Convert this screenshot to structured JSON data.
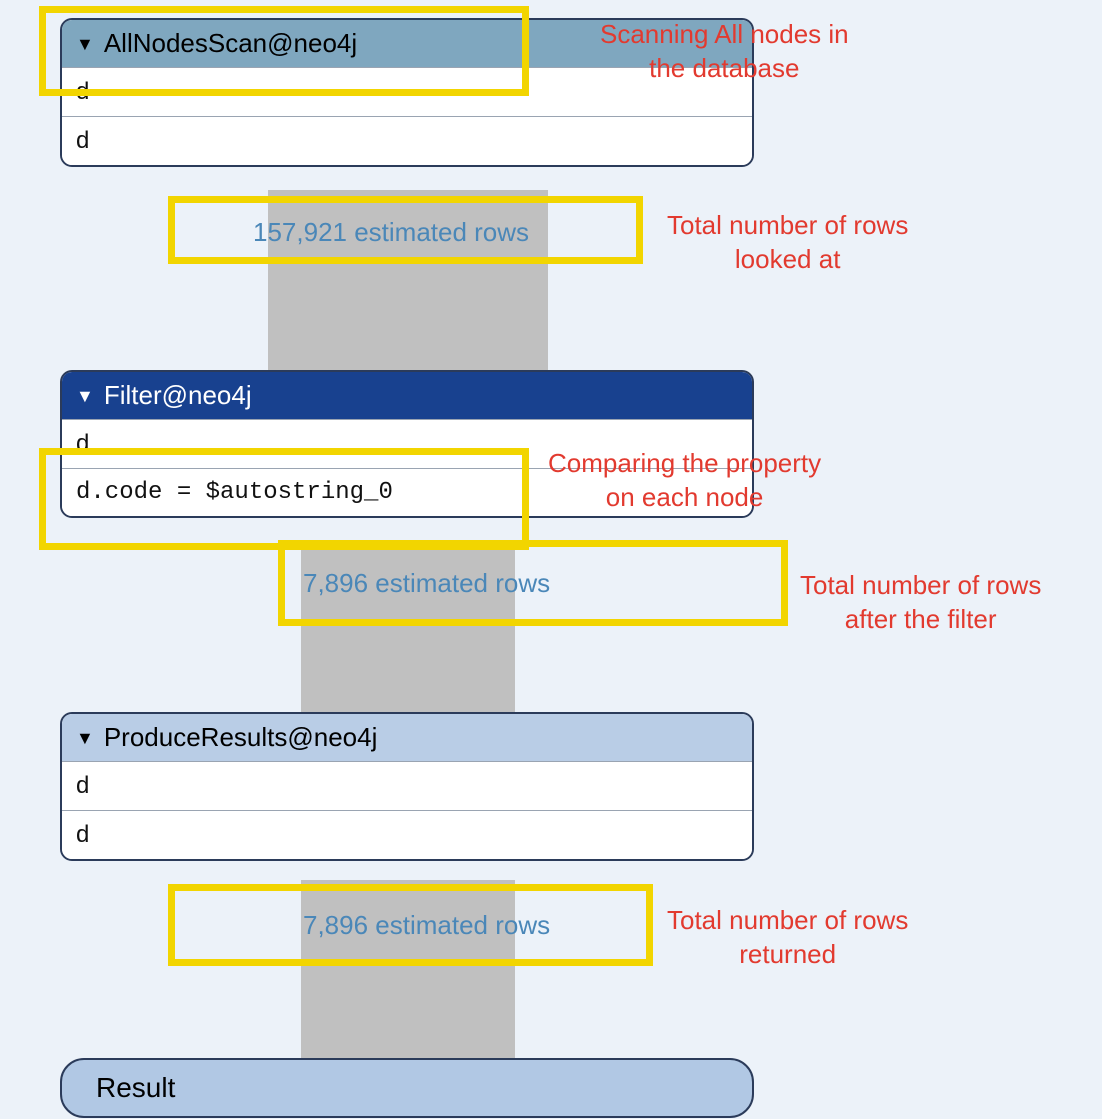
{
  "nodes": {
    "allscan": {
      "title": "AllNodesScan@neo4j",
      "row1": "d",
      "row2": "d"
    },
    "filter": {
      "title": "Filter@neo4j",
      "row1": "d",
      "row2": "d.code = $autostring_0"
    },
    "produce": {
      "title": "ProduceResults@neo4j",
      "row1": "d",
      "row2": "d"
    },
    "result": {
      "label": "Result"
    }
  },
  "estimates": {
    "after_scan": "157,921 estimated rows",
    "after_filter": "7,896 estimated rows",
    "after_produce": "7,896 estimated rows"
  },
  "annotations": {
    "scan_title": "Scanning All nodes in\nthe database",
    "scan_rows": "Total number of rows\nlooked at",
    "filter_expr": "Comparing the property\non each node",
    "filter_rows": "Total number of rows\nafter the filter",
    "produce_rows": "Total number of rows\nreturned"
  },
  "colors": {
    "background": "#ecf2f9",
    "pipe": "#c0c0c0",
    "highlight": "#f2d500",
    "annotation": "#e23a2f",
    "estimate": "#4a87b8",
    "hdr_allscan": "#7fa7bf",
    "hdr_filter": "#18418f",
    "hdr_produce": "#b9cde6",
    "hdr_result": "#b1c8e4"
  }
}
